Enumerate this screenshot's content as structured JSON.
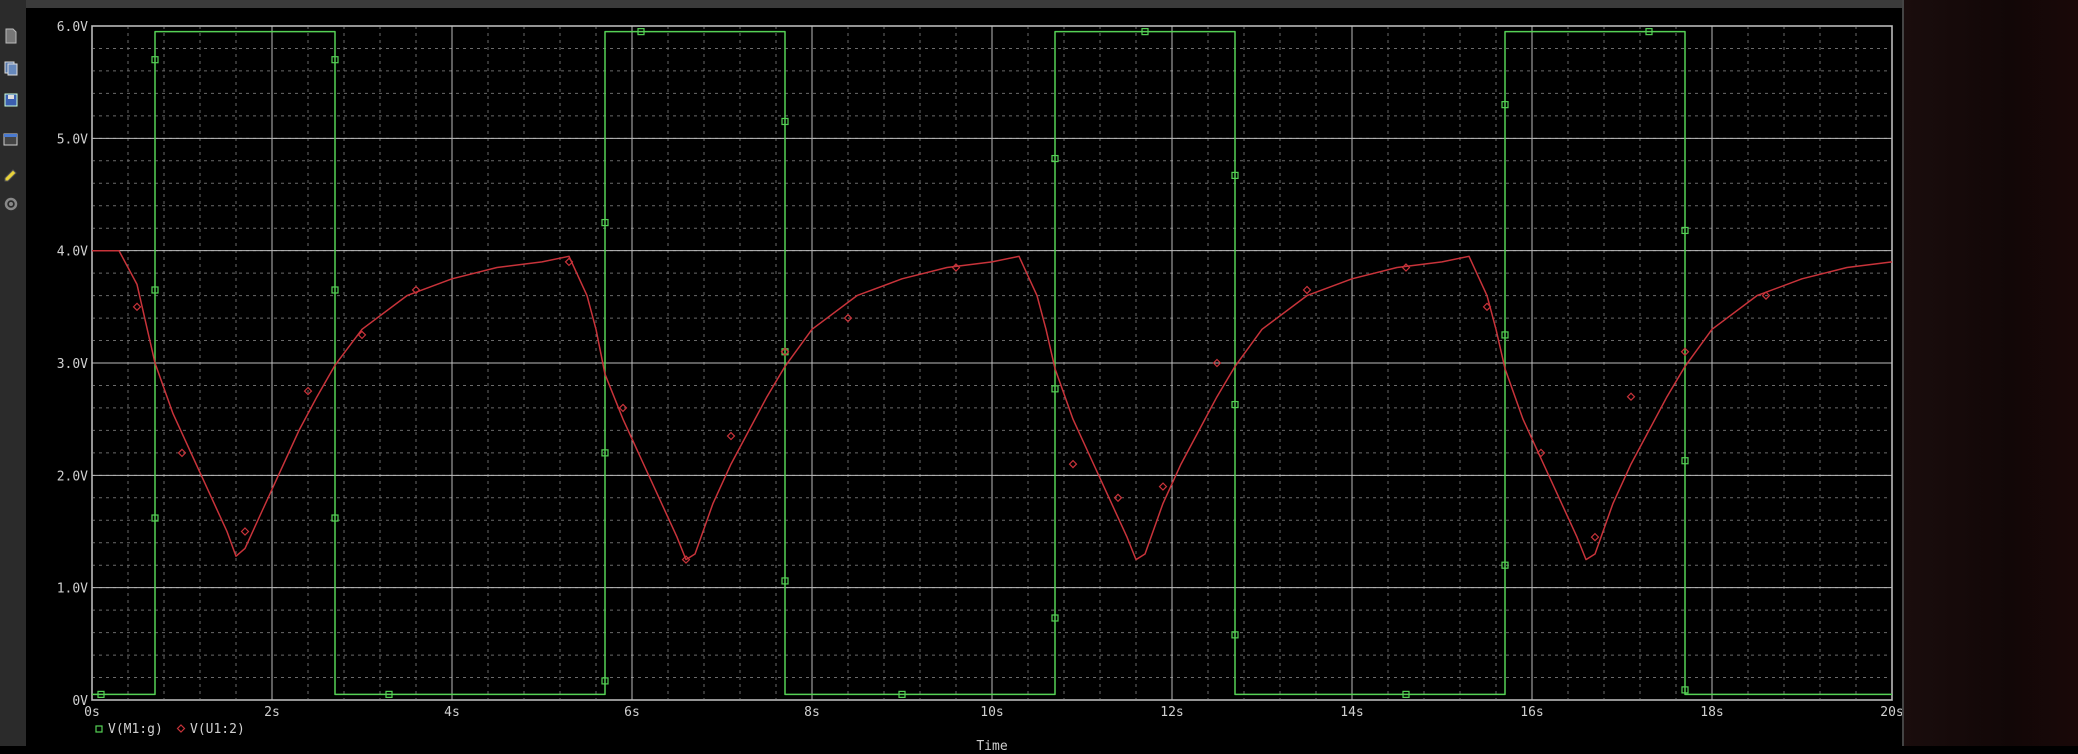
{
  "colors": {
    "series1": "#55d155",
    "series2": "#c8333a",
    "axis": "#d8d8d8",
    "grid_major": "#bdbdbd",
    "grid_minor": "#6a6a6a",
    "background": "#000000"
  },
  "toolbar": {
    "icons": [
      "document-icon",
      "copy-icon",
      "save-icon",
      "window-icon",
      "marker-icon",
      "gear-icon"
    ]
  },
  "chart_data": {
    "type": "line",
    "title": "",
    "xlabel": "Time",
    "ylabel": "",
    "xlim": [
      0,
      20
    ],
    "ylim": [
      0,
      6
    ],
    "x_ticks": [
      0,
      2,
      4,
      6,
      8,
      10,
      12,
      14,
      16,
      18,
      20
    ],
    "x_tick_labels": [
      "0s",
      "2s",
      "4s",
      "6s",
      "8s",
      "10s",
      "12s",
      "14s",
      "16s",
      "18s",
      "20s"
    ],
    "y_ticks": [
      0,
      1,
      2,
      3,
      4,
      5,
      6
    ],
    "y_tick_labels": [
      "0V",
      "1.0V",
      "2.0V",
      "3.0V",
      "4.0V",
      "5.0V",
      "6.0V"
    ],
    "grid": true,
    "legend_position": "bottom-left",
    "series": [
      {
        "name": "V(M1:g)",
        "marker": "square",
        "x": [
          0,
          0.7,
          0.7,
          2.7,
          2.7,
          5.7,
          5.7,
          7.7,
          7.7,
          10.7,
          10.7,
          12.7,
          12.7,
          15.7,
          15.7,
          17.7,
          17.7,
          20
        ],
        "y": [
          0.05,
          0.05,
          5.95,
          5.95,
          0.05,
          0.05,
          5.95,
          5.95,
          0.05,
          0.05,
          5.95,
          5.95,
          0.05,
          0.05,
          5.95,
          5.95,
          0.05,
          0.05
        ],
        "marker_points": [
          [
            0.1,
            0.05
          ],
          [
            0.7,
            1.62
          ],
          [
            0.7,
            3.65
          ],
          [
            0.7,
            5.7
          ],
          [
            2.7,
            5.7
          ],
          [
            2.7,
            3.65
          ],
          [
            2.7,
            1.62
          ],
          [
            3.3,
            0.05
          ],
          [
            5.7,
            0.17
          ],
          [
            5.7,
            2.2
          ],
          [
            5.7,
            4.25
          ],
          [
            6.1,
            5.95
          ],
          [
            7.7,
            5.15
          ],
          [
            7.7,
            3.1
          ],
          [
            7.7,
            1.06
          ],
          [
            9.0,
            0.05
          ],
          [
            10.7,
            0.73
          ],
          [
            10.7,
            2.77
          ],
          [
            10.7,
            4.82
          ],
          [
            11.7,
            5.95
          ],
          [
            12.7,
            4.67
          ],
          [
            12.7,
            2.63
          ],
          [
            12.7,
            0.58
          ],
          [
            14.6,
            0.05
          ],
          [
            15.7,
            1.2
          ],
          [
            15.7,
            3.25
          ],
          [
            15.7,
            5.3
          ],
          [
            17.3,
            5.95
          ],
          [
            17.7,
            4.18
          ],
          [
            17.7,
            2.13
          ],
          [
            17.7,
            0.09
          ]
        ]
      },
      {
        "name": "V(U1:2)",
        "marker": "diamond",
        "x": [
          0,
          0.3,
          0.5,
          0.7,
          0.9,
          1.1,
          1.3,
          1.5,
          1.6,
          1.7,
          1.9,
          2.1,
          2.3,
          2.5,
          2.7,
          3.0,
          3.5,
          4.0,
          4.5,
          5.0,
          5.3,
          5.5,
          5.6,
          5.7,
          5.9,
          6.1,
          6.3,
          6.5,
          6.6,
          6.7,
          6.9,
          7.1,
          7.3,
          7.5,
          7.7,
          8.0,
          8.5,
          9.0,
          9.5,
          10.0,
          10.3,
          10.5,
          10.6,
          10.7,
          10.9,
          11.1,
          11.3,
          11.5,
          11.6,
          11.7,
          11.9,
          12.1,
          12.3,
          12.5,
          12.7,
          13.0,
          13.5,
          14.0,
          14.5,
          15.0,
          15.3,
          15.5,
          15.6,
          15.7,
          15.9,
          16.1,
          16.3,
          16.5,
          16.6,
          16.7,
          16.9,
          17.1,
          17.3,
          17.5,
          17.7,
          18.0,
          18.5,
          19.0,
          19.5,
          20.0
        ],
        "y": [
          4.0,
          4.0,
          3.7,
          3.0,
          2.55,
          2.2,
          1.85,
          1.5,
          1.28,
          1.35,
          1.7,
          2.05,
          2.4,
          2.7,
          2.98,
          3.3,
          3.6,
          3.75,
          3.85,
          3.9,
          3.95,
          3.6,
          3.3,
          2.9,
          2.5,
          2.15,
          1.8,
          1.45,
          1.25,
          1.3,
          1.75,
          2.1,
          2.4,
          2.7,
          2.97,
          3.3,
          3.6,
          3.75,
          3.85,
          3.9,
          3.95,
          3.6,
          3.3,
          2.95,
          2.5,
          2.15,
          1.8,
          1.45,
          1.25,
          1.3,
          1.75,
          2.1,
          2.4,
          2.7,
          2.97,
          3.3,
          3.6,
          3.75,
          3.85,
          3.9,
          3.95,
          3.6,
          3.3,
          2.95,
          2.5,
          2.15,
          1.8,
          1.45,
          1.25,
          1.3,
          1.75,
          2.1,
          2.4,
          2.7,
          2.97,
          3.3,
          3.6,
          3.75,
          3.85,
          3.9
        ],
        "marker_points": [
          [
            0.5,
            3.5
          ],
          [
            1.0,
            2.2
          ],
          [
            1.7,
            1.5
          ],
          [
            2.4,
            2.75
          ],
          [
            3.0,
            3.25
          ],
          [
            3.6,
            3.65
          ],
          [
            5.3,
            3.9
          ],
          [
            5.9,
            2.6
          ],
          [
            6.6,
            1.25
          ],
          [
            7.1,
            2.35
          ],
          [
            7.7,
            3.1
          ],
          [
            8.4,
            3.4
          ],
          [
            9.6,
            3.85
          ],
          [
            10.9,
            2.1
          ],
          [
            11.4,
            1.8
          ],
          [
            11.9,
            1.9
          ],
          [
            12.5,
            3.0
          ],
          [
            13.5,
            3.65
          ],
          [
            14.6,
            3.85
          ],
          [
            15.5,
            3.5
          ],
          [
            16.1,
            2.2
          ],
          [
            16.7,
            1.45
          ],
          [
            17.1,
            2.7
          ],
          [
            17.7,
            3.1
          ],
          [
            18.6,
            3.6
          ]
        ]
      }
    ]
  }
}
